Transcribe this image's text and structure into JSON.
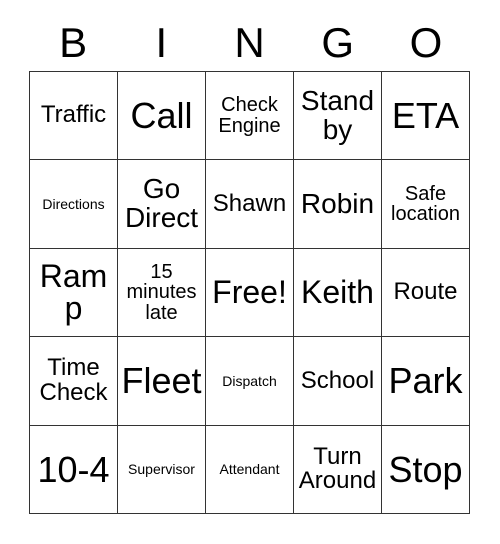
{
  "card": {
    "title_letters": [
      "B",
      "I",
      "N",
      "G",
      "O"
    ],
    "grid": {
      "columns": 5,
      "rows": 5,
      "border_color": "#333333",
      "background_color": "#ffffff",
      "text_color": "#000000"
    },
    "cells": [
      {
        "text": "Traffic",
        "size": "md",
        "column": "B",
        "row": 1
      },
      {
        "text": "Call",
        "size": "xxl",
        "column": "I",
        "row": 1
      },
      {
        "text": "Check Engine",
        "size": "sm",
        "column": "N",
        "row": 1
      },
      {
        "text": "Stand by",
        "size": "lg",
        "column": "G",
        "row": 1
      },
      {
        "text": "ETA",
        "size": "xxl",
        "column": "O",
        "row": 1
      },
      {
        "text": "Directions",
        "size": "xs",
        "column": "B",
        "row": 2
      },
      {
        "text": "Go Direct",
        "size": "lg",
        "column": "I",
        "row": 2
      },
      {
        "text": "Shawn",
        "size": "md",
        "column": "N",
        "row": 2
      },
      {
        "text": "Robin",
        "size": "lg",
        "column": "G",
        "row": 2
      },
      {
        "text": "Safe location",
        "size": "sm",
        "column": "O",
        "row": 2
      },
      {
        "text": "Ramp",
        "size": "xl",
        "column": "B",
        "row": 3
      },
      {
        "text": "15 minutes late",
        "size": "sm",
        "column": "I",
        "row": 3
      },
      {
        "text": "Free!",
        "size": "xl",
        "column": "N",
        "row": 3
      },
      {
        "text": "Keith",
        "size": "xl",
        "column": "G",
        "row": 3
      },
      {
        "text": "Route",
        "size": "md",
        "column": "O",
        "row": 3
      },
      {
        "text": "Time Check",
        "size": "md",
        "column": "B",
        "row": 4
      },
      {
        "text": "Fleet",
        "size": "xxl",
        "column": "I",
        "row": 4
      },
      {
        "text": "Dispatch",
        "size": "xs",
        "column": "N",
        "row": 4
      },
      {
        "text": "School",
        "size": "md",
        "column": "G",
        "row": 4
      },
      {
        "text": "Park",
        "size": "xxl",
        "column": "O",
        "row": 4
      },
      {
        "text": "10-4",
        "size": "xxl",
        "column": "B",
        "row": 5
      },
      {
        "text": "Supervisor",
        "size": "xs",
        "column": "I",
        "row": 5
      },
      {
        "text": "Attendant",
        "size": "xs",
        "column": "N",
        "row": 5
      },
      {
        "text": "Turn Around",
        "size": "md",
        "column": "G",
        "row": 5
      },
      {
        "text": "Stop",
        "size": "xxl",
        "column": "O",
        "row": 5
      }
    ]
  }
}
